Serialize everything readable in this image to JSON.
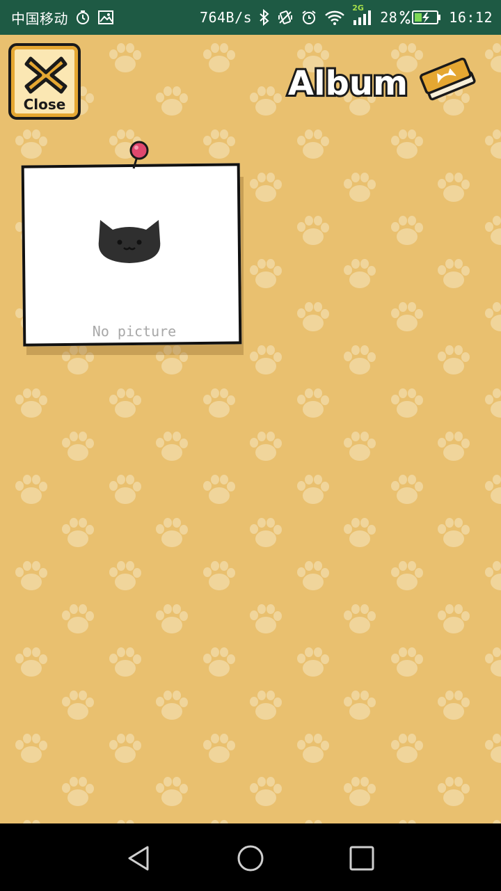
{
  "status_bar": {
    "carrier": "中国移动",
    "net_speed": "764B/s",
    "net_type": "2G",
    "battery": "28",
    "time": "16:12"
  },
  "game": {
    "close_label": "Close",
    "title": "Album",
    "photos": [
      {
        "caption": "No picture"
      }
    ]
  },
  "colors": {
    "background": "#e9c06f",
    "paw": "#f0d59b",
    "status_bar": "#1e5a44",
    "close_orange": "#e5a732",
    "pin": "#e0486e",
    "cat": "#2f2f2f"
  },
  "icons": [
    "alarm-icon",
    "image-icon",
    "bluetooth-icon",
    "vibrate-icon",
    "wifi-icon",
    "signal-icon",
    "battery-icon",
    "close-x-icon",
    "book-icon",
    "pin-icon",
    "cat-icon",
    "back-icon",
    "home-icon",
    "recent-icon"
  ]
}
